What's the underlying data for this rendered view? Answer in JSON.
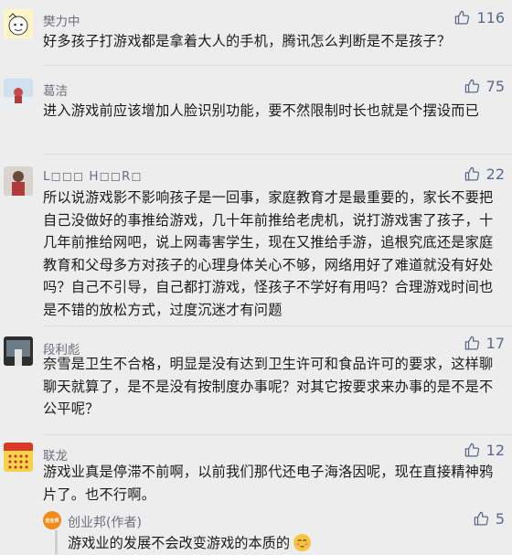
{
  "comments": [
    {
      "name": "樊力中",
      "likes": "116",
      "text": "好多孩子打游戏都是拿着大人的手机，腾讯怎么判断是不是孩子？"
    },
    {
      "name": "葛洁",
      "likes": "75",
      "text": "进入游戏前应该增加人脸识别功能，要不然限制时长也就是个摆设而已"
    },
    {
      "name": "L◻◻◻ H◻◻R◻",
      "likes": "22",
      "text": "所以说游戏影不影响孩子是一回事，家庭教育才是最重要的，家长不要把自己没做好的事推给游戏，几十年前推给老虎机，说打游戏害了孩子，十几年前推给网吧，说上网毒害学生，现在又推给手游，追根究底还是家庭教育和父母多方对孩子的心理身体关心不够，网络用好了难道就没有好处吗？自己不引导，自己都打游戏，怪孩子不学好有用吗？合理游戏时间也是不错的放松方式，过度沉迷才有问题"
    },
    {
      "name": "段利彪",
      "likes": "17",
      "text": "奈雪是卫生不合格，明显是没有达到卫生许可和食品许可的要求，这样聊聊天就算了，是不是没有按制度办事呢？对其它按要求来办事的是不是不公平呢？"
    },
    {
      "name": "联龙",
      "likes": "12",
      "text": "游戏业真是停滞不前啊，以前我们那代还电子海洛因呢，现在直接精神鸦片了。也不行啊。"
    }
  ],
  "reply": {
    "avatar_text": "创业邦",
    "name": "创业邦(作者)",
    "likes": "5",
    "text": "游戏业的发展不会改变游戏的本质的"
  },
  "icons": {
    "like": "thumbs-up-icon"
  },
  "colors": {
    "background": "#ededed",
    "name": "#6d6f7a",
    "like": "#5a6a8c"
  }
}
